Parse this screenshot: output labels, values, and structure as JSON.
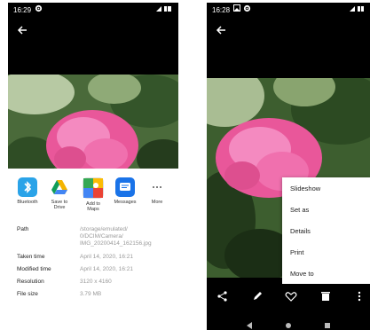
{
  "left_screen": {
    "status": {
      "time": "16:29"
    },
    "share_apps": [
      {
        "label": "Bluetooth",
        "icon": "bluetooth-icon",
        "color": "#2aa3e8"
      },
      {
        "label": "Save to\nDrive",
        "icon": "google-drive-icon",
        "color": "#ffffff"
      },
      {
        "label": "Add to\nMaps",
        "icon": "google-maps-icon",
        "color": "#ffffff"
      },
      {
        "label": "Messages",
        "icon": "messages-icon",
        "color": "#1a73e8"
      },
      {
        "label": "More",
        "icon": "more-horizontal-icon",
        "color": "#ffffff"
      }
    ],
    "details": [
      {
        "key": "Path",
        "value": "/storage/emulated/\n0/DCIM/Camera/\nIMG_20200414_162156.jpg"
      },
      {
        "key": "Taken time",
        "value": "April 14, 2020, 16:21"
      },
      {
        "key": "Modified time",
        "value": "April 14, 2020, 16:21"
      },
      {
        "key": "Resolution",
        "value": "3120 x 4160"
      },
      {
        "key": "File size",
        "value": "3.79 MB"
      }
    ]
  },
  "right_screen": {
    "status": {
      "time": "16:28"
    },
    "menu": [
      "Slideshow",
      "Set as",
      "Details",
      "Print",
      "Move to"
    ]
  },
  "colors": {
    "accent": "#1a73e8",
    "flower": "#f06ca8",
    "leaf": "#3f6b2a"
  }
}
